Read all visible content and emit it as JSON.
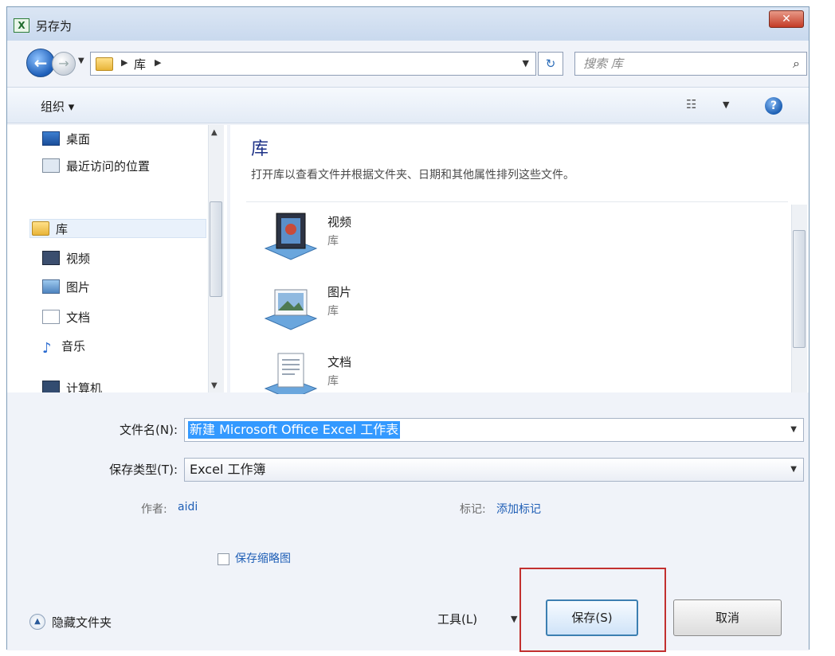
{
  "window": {
    "title": "另存为",
    "close_glyph": "✕",
    "app_icon_label": "X"
  },
  "address": {
    "segment": "库",
    "refresh_glyph": "↻"
  },
  "search": {
    "placeholder": "搜索 库"
  },
  "toolbar": {
    "organize": "组织 ▾"
  },
  "nav": {
    "items": [
      {
        "label": "桌面",
        "icon": "desktop-icon"
      },
      {
        "label": "最近访问的位置",
        "icon": "recent-places-icon"
      },
      {
        "label": "库",
        "icon": "library-folder-icon",
        "selected": true
      },
      {
        "label": "视频",
        "icon": "video-library-icon"
      },
      {
        "label": "图片",
        "icon": "pictures-library-icon"
      },
      {
        "label": "文档",
        "icon": "documents-library-icon"
      },
      {
        "label": "音乐",
        "icon": "music-note-icon"
      },
      {
        "label": "计算机",
        "icon": "computer-icon"
      }
    ]
  },
  "content": {
    "title": "库",
    "description": "打开库以查看文件并根据文件夹、日期和其他属性排列这些文件。",
    "items": [
      {
        "name": "视频",
        "sub": "库",
        "icon": "video-library-icon"
      },
      {
        "name": "图片",
        "sub": "库",
        "icon": "pictures-library-icon"
      },
      {
        "name": "文档",
        "sub": "库",
        "icon": "documents-library-icon"
      }
    ]
  },
  "form": {
    "filename_label": "文件名(N):",
    "filename_value": "新建 Microsoft Office Excel 工作表",
    "filetype_label": "保存类型(T):",
    "filetype_value": "Excel 工作簿",
    "author_label": "作者:",
    "author_value": "aidi",
    "tags_label": "标记:",
    "tags_value": "添加标记",
    "thumbnail_label": "保存缩略图",
    "thumbnail_checked": false
  },
  "footer": {
    "hide_folders": "隐藏文件夹",
    "tools": "工具(L)",
    "save": "保存(S)",
    "cancel": "取消"
  },
  "colors": {
    "accent": "#1f5fb6",
    "highlight_box": "#c2302f",
    "selection": "#3399ff"
  }
}
